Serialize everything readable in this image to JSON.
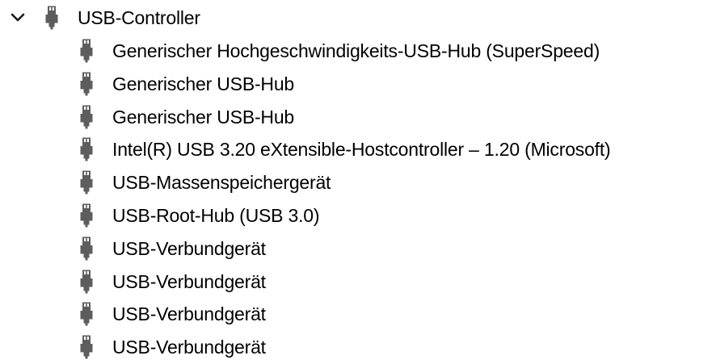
{
  "tree": {
    "category": {
      "label": "USB-Controller",
      "expanded": true,
      "icon": "usb-plug-icon"
    },
    "devices": [
      {
        "label": "Generischer Hochgeschwindigkeits-USB-Hub (SuperSpeed)",
        "icon": "usb-plug-icon"
      },
      {
        "label": "Generischer USB-Hub",
        "icon": "usb-plug-icon"
      },
      {
        "label": "Generischer USB-Hub",
        "icon": "usb-plug-icon"
      },
      {
        "label": "Intel(R) USB 3.20 eXtensible-Hostcontroller – 1.20 (Microsoft)",
        "icon": "usb-plug-icon"
      },
      {
        "label": "USB-Massenspeichergerät",
        "icon": "usb-plug-icon"
      },
      {
        "label": "USB-Root-Hub (USB 3.0)",
        "icon": "usb-plug-icon"
      },
      {
        "label": "USB-Verbundgerät",
        "icon": "usb-plug-icon"
      },
      {
        "label": "USB-Verbundgerät",
        "icon": "usb-plug-icon"
      },
      {
        "label": "USB-Verbundgerät",
        "icon": "usb-plug-icon"
      },
      {
        "label": "USB-Verbundgerät",
        "icon": "usb-plug-icon"
      }
    ]
  },
  "colors": {
    "icon_fill": "#5d5d5d",
    "icon_contacts": "#ffffff",
    "text": "#000000",
    "background": "#ffffff"
  }
}
